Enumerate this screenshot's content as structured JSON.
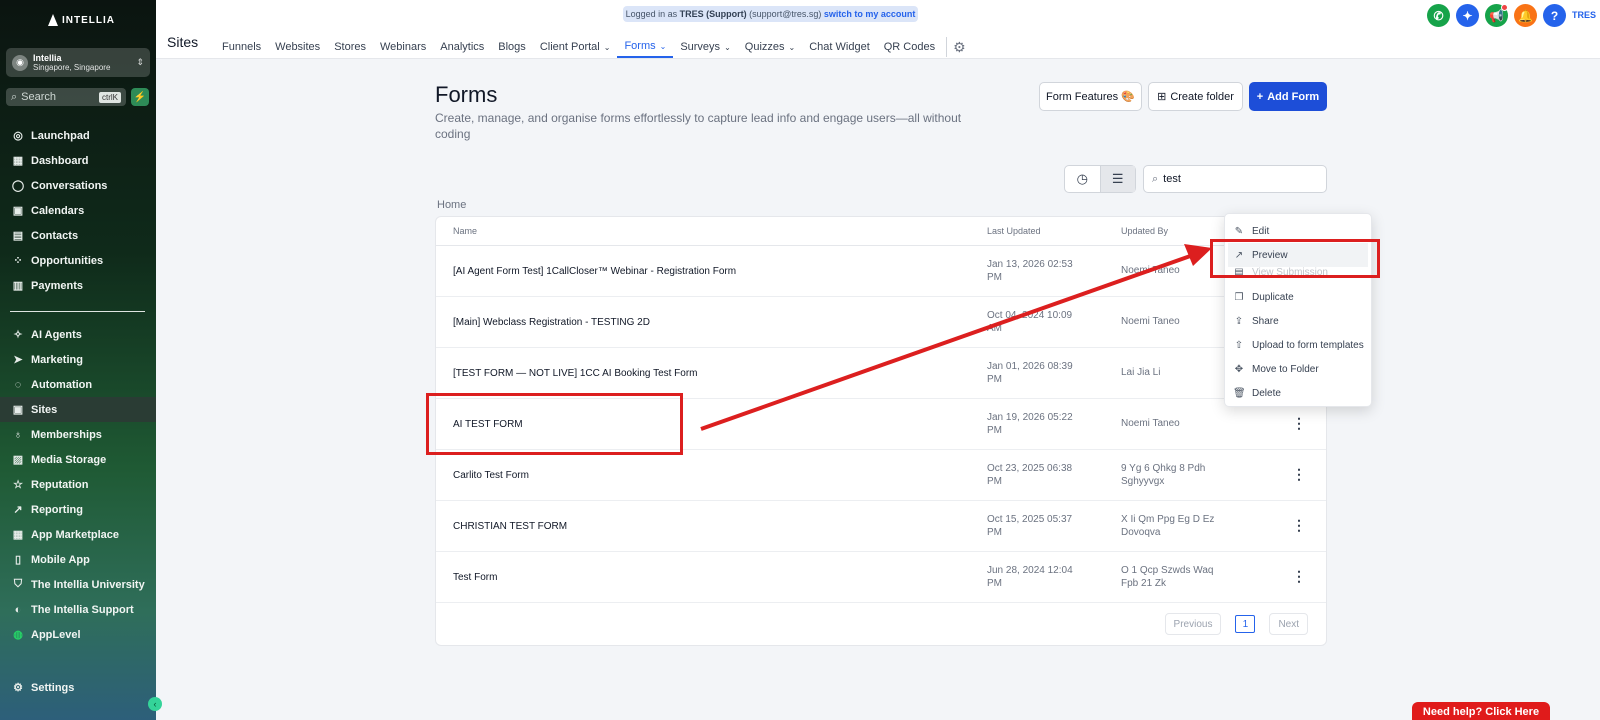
{
  "brand": {
    "name": "INTELLIA"
  },
  "account": {
    "name": "Intellia",
    "location": "Singapore, Singapore"
  },
  "sidebar_search": {
    "placeholder": "Search",
    "shortcut": "ctrlK"
  },
  "sidebar": {
    "items_top": [
      {
        "label": "Launchpad",
        "icon": "rocket-icon"
      },
      {
        "label": "Dashboard",
        "icon": "grid-icon"
      },
      {
        "label": "Conversations",
        "icon": "chat-icon"
      },
      {
        "label": "Calendars",
        "icon": "calendar-icon"
      },
      {
        "label": "Contacts",
        "icon": "contacts-icon"
      },
      {
        "label": "Opportunities",
        "icon": "opportunities-icon"
      },
      {
        "label": "Payments",
        "icon": "payments-icon"
      }
    ],
    "items_bottom": [
      {
        "label": "AI Agents",
        "icon": "sparkle-icon"
      },
      {
        "label": "Marketing",
        "icon": "send-icon"
      },
      {
        "label": "Automation",
        "icon": "automation-icon"
      },
      {
        "label": "Sites",
        "icon": "sites-icon",
        "active": true
      },
      {
        "label": "Memberships",
        "icon": "membership-icon"
      },
      {
        "label": "Media Storage",
        "icon": "media-icon"
      },
      {
        "label": "Reputation",
        "icon": "star-icon"
      },
      {
        "label": "Reporting",
        "icon": "chart-line-icon"
      },
      {
        "label": "App Marketplace",
        "icon": "apps-icon"
      },
      {
        "label": "Mobile App",
        "icon": "mobile-icon"
      },
      {
        "label": "The Intellia University",
        "icon": "graduation-icon"
      },
      {
        "label": "The Intellia Support",
        "icon": "headset-icon"
      },
      {
        "label": "AppLevel",
        "icon": "whatsapp-icon"
      }
    ],
    "settings": "Settings"
  },
  "banner": {
    "prefix": "Logged in as",
    "user": "TRES (Support)",
    "email": "(support@tres.sg)",
    "switch": "switch to my account"
  },
  "header": {
    "title": "Sites",
    "tabs": [
      {
        "label": "Funnels"
      },
      {
        "label": "Websites"
      },
      {
        "label": "Stores"
      },
      {
        "label": "Webinars"
      },
      {
        "label": "Analytics"
      },
      {
        "label": "Blogs"
      },
      {
        "label": "Client Portal",
        "caret": true
      },
      {
        "label": "Forms",
        "caret": true,
        "active": true
      },
      {
        "label": "Surveys",
        "caret": true
      },
      {
        "label": "Quizzes",
        "caret": true
      },
      {
        "label": "Chat Widget"
      },
      {
        "label": "QR Codes"
      }
    ],
    "user_initials": "TRES",
    "colors": {
      "phone": "#16a34a",
      "magic": "#2563eb",
      "megaphone": "#16a34a",
      "bell": "#f97316",
      "help": "#2563eb"
    }
  },
  "main": {
    "title": "Forms",
    "description": "Create, manage, and organise forms effortlessly to capture lead info and engage users—all without coding",
    "buttons": {
      "features": "Form Features 🎨",
      "create_folder": "Create folder",
      "add_form": "Add Form"
    },
    "search_value": "test",
    "breadcrumb": "Home",
    "columns": {
      "name": "Name",
      "updated": "Last Updated",
      "by": "Updated By"
    },
    "rows": [
      {
        "name": "[AI Agent Form Test] 1CallCloser™ Webinar - Registration Form",
        "date": "Jan 13, 2026 02:53",
        "time": "PM",
        "by": "Noemi Taneo"
      },
      {
        "name": "[Main] Webclass Registration - TESTING 2D",
        "date": "Oct 04, 2024 10:09",
        "time": "AM",
        "by": "Noemi Taneo"
      },
      {
        "name": "[TEST FORM — NOT LIVE] 1CC AI Booking Test Form",
        "date": "Jan 01, 2026 08:39",
        "time": "PM",
        "by": "Lai Jia Li"
      },
      {
        "name": "AI TEST FORM",
        "date": "Jan 19, 2026 05:22",
        "time": "PM",
        "by": "Noemi Taneo"
      },
      {
        "name": "Carlito Test Form",
        "date": "Oct 23, 2025 06:38",
        "time": "PM",
        "by": "9 Yg 6 Qhkg 8 Pdh Sghyyvgx"
      },
      {
        "name": "CHRISTIAN TEST FORM",
        "date": "Oct 15, 2025 05:37",
        "time": "PM",
        "by": "X Ii Qm Ppg Eg D Ez Dovoqva"
      },
      {
        "name": "Test Form",
        "date": "Jun 28, 2024 12:04",
        "time": "PM",
        "by": "O 1 Qcp Szwds Waq Fpb 21 Zk"
      }
    ],
    "pager": {
      "prev": "Previous",
      "page": "1",
      "next": "Next"
    }
  },
  "menu": [
    {
      "label": "Edit",
      "icon": "pencil-icon"
    },
    {
      "label": "Preview",
      "icon": "external-link-icon"
    },
    {
      "label": "View Submission",
      "icon": "document-icon"
    },
    {
      "label": "Duplicate",
      "icon": "copy-icon"
    },
    {
      "label": "Share",
      "icon": "share-icon"
    },
    {
      "label": "Upload to form templates",
      "icon": "upload-icon"
    },
    {
      "label": "Move to Folder",
      "icon": "move-icon"
    },
    {
      "label": "Delete",
      "icon": "trash-icon"
    }
  ],
  "help_button": "Need help? Click Here",
  "annotation_color": "#dc1f1f"
}
